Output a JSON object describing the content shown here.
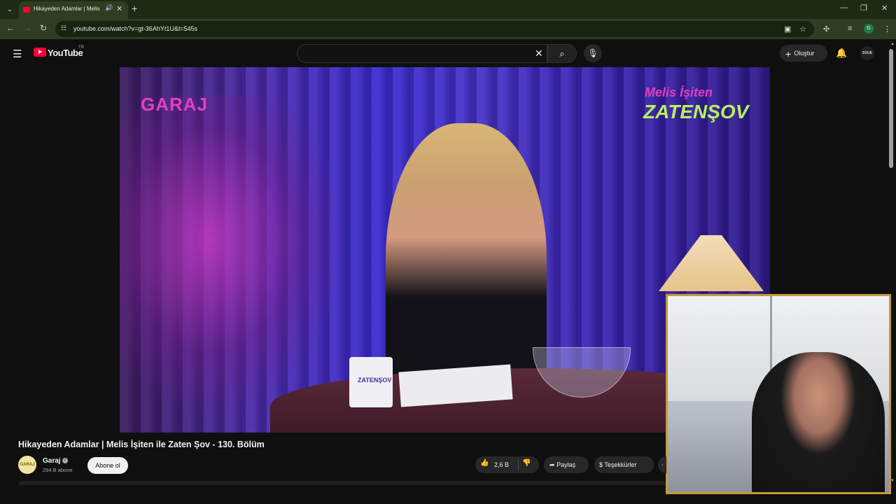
{
  "browser": {
    "tab_title": "Hikayeden Adamlar | Melis",
    "url": "youtube.com/watch?v=gt-36AhYt1U&t=545s",
    "profile_initial": "G"
  },
  "youtube": {
    "logo_text": "YouTube",
    "country": "TR",
    "create_label": "Oluştur",
    "avatar_text": "SOUE"
  },
  "video": {
    "overlay_left": "GARAJ",
    "overlay_right_line1": "Melis İşiten",
    "overlay_right_line2": "ZATENŞOV",
    "mug_text": "ZATENŞOV",
    "title": "Hikayeden Adamlar | Melis İşiten ile Zaten Şov - 130. Bölüm"
  },
  "channel": {
    "avatar_text": "GARAJ",
    "name": "Garaj",
    "subscribers": "294 B abone",
    "subscribe_label": "Abone ol"
  },
  "actions": {
    "likes": "2,6 B",
    "share_label": "Paylaş",
    "thanks_label": "Teşekkürler"
  },
  "colors": {
    "accent_red": "#ff0033",
    "chrome_theme": "#2f3d22",
    "webcam_border": "#c69a3a"
  }
}
